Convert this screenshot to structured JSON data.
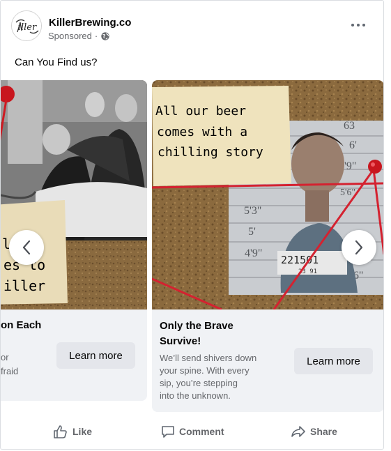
{
  "post": {
    "page_name": "KillerBrewing.co",
    "sponsored_label": "Sponsored",
    "caption": "Can You Find us?",
    "avatar_text": "iller"
  },
  "cards": [
    {
      "title": "on Each",
      "desc_line1": "or",
      "desc_line2": "fraid",
      "button": "Learn more",
      "note_lines": [
        "l   e",
        "es to",
        "iller"
      ]
    },
    {
      "title_line1": "Only the Brave",
      "title_line2": "Survive!",
      "desc": [
        "We’ll send shivers down",
        "your spine. With every",
        "sip, you’re stepping",
        "into the unknown."
      ],
      "button": "Learn more",
      "note_lines": [
        "All our beer",
        "comes with a",
        "chilling story"
      ],
      "mugshot_numbers": [
        "63",
        "6'",
        "5'9\"",
        "5'3\"",
        "5'",
        "4'9\"",
        "4'6\"",
        "221501",
        "23  91",
        "5'6\""
      ]
    }
  ],
  "actions": {
    "like": "Like",
    "comment": "Comment",
    "share": "Share"
  },
  "icons": {
    "more": "more-options-icon",
    "globe": "globe-icon",
    "prev": "chevron-left-icon",
    "next": "chevron-right-icon",
    "like": "thumbs-up-icon",
    "comment": "comment-icon",
    "share": "share-icon"
  }
}
